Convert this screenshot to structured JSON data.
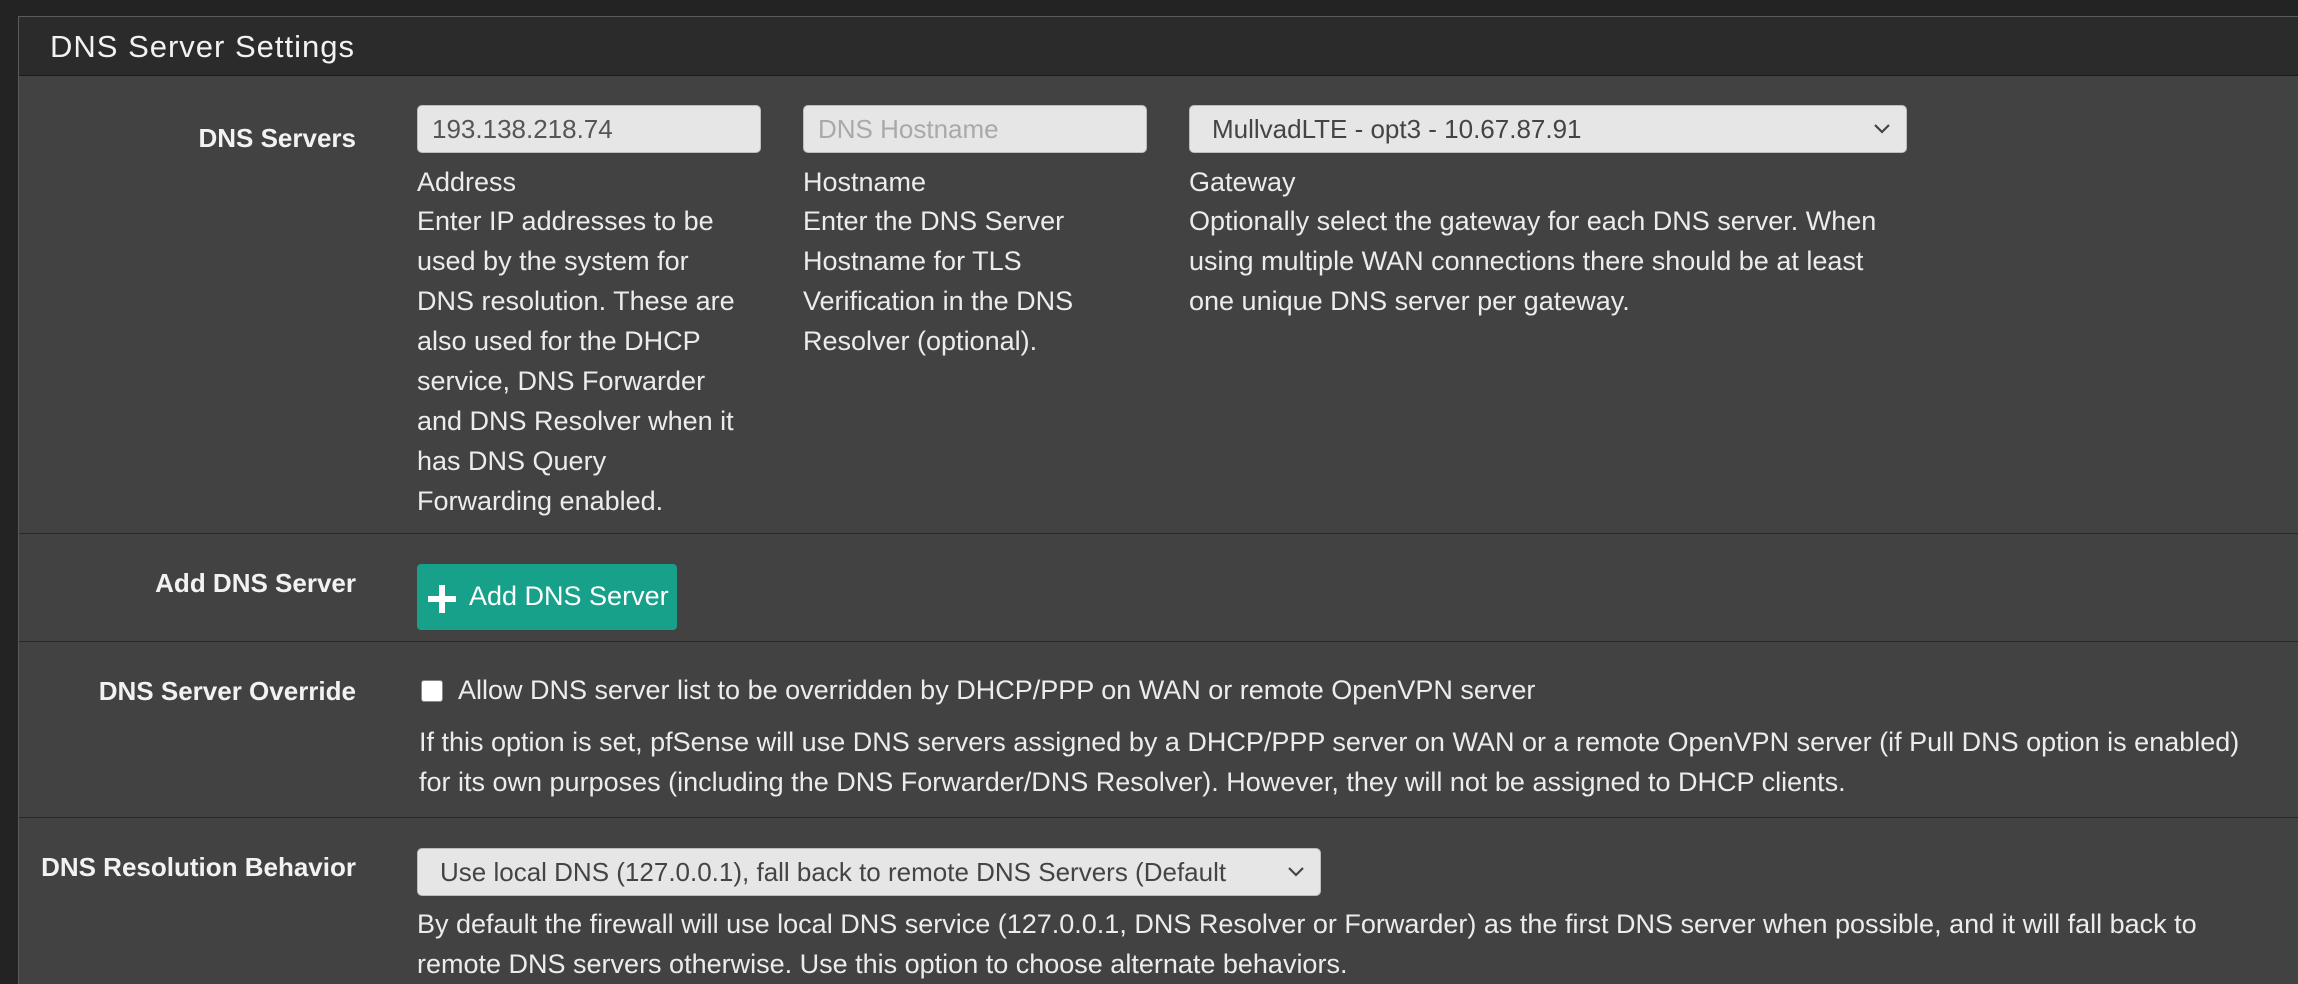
{
  "panel": {
    "title": "DNS Server Settings"
  },
  "dns_servers": {
    "label": "DNS Servers",
    "address_value": "193.138.218.74",
    "hostname_placeholder": "DNS Hostname",
    "gateway_selected": "MullvadLTE - opt3 - 10.67.87.91",
    "address_heading": "Address",
    "address_help": [
      "Enter IP addresses to be",
      "used by the system for",
      "DNS resolution. These are",
      "also used for the DHCP",
      "service, DNS Forwarder",
      "and DNS Resolver when it",
      "has DNS Query",
      "Forwarding enabled."
    ],
    "hostname_heading": "Hostname",
    "hostname_help": [
      "Enter the DNS Server",
      "Hostname for TLS",
      "Verification in the DNS",
      "Resolver (optional)."
    ],
    "gateway_heading": "Gateway",
    "gateway_help": [
      "Optionally select the gateway for each DNS server. When",
      "using multiple WAN connections there should be at least",
      "one unique DNS server per gateway."
    ]
  },
  "add_dns_server": {
    "label": "Add DNS Server",
    "button_label": "Add DNS Server",
    "button_icon": "plus-icon"
  },
  "dns_override": {
    "label": "DNS Server Override",
    "checkbox_label": "Allow DNS server list to be overridden by DHCP/PPP on WAN or remote OpenVPN server",
    "checked": false,
    "help": [
      "If this option is set, pfSense will use DNS servers assigned by a DHCP/PPP server on WAN or a remote OpenVPN server (if Pull DNS option is enabled)",
      "for its own purposes (including the DNS Forwarder/DNS Resolver). However, they will not be assigned to DHCP clients."
    ]
  },
  "dns_resolution": {
    "label": "DNS Resolution Behavior",
    "selected": "Use local DNS (127.0.0.1), fall back to remote DNS Servers (Default",
    "help": [
      "By default the firewall will use local DNS service (127.0.0.1, DNS Resolver or Forwarder) as the first DNS server when possible, and it will fall back to",
      "remote DNS servers otherwise. Use this option to choose alternate behaviors."
    ]
  },
  "colors": {
    "panel_bg": "#424242",
    "heading_bg": "#2b2b2b",
    "button_green": "#17a08a",
    "input_bg": "#e6e6e6"
  }
}
